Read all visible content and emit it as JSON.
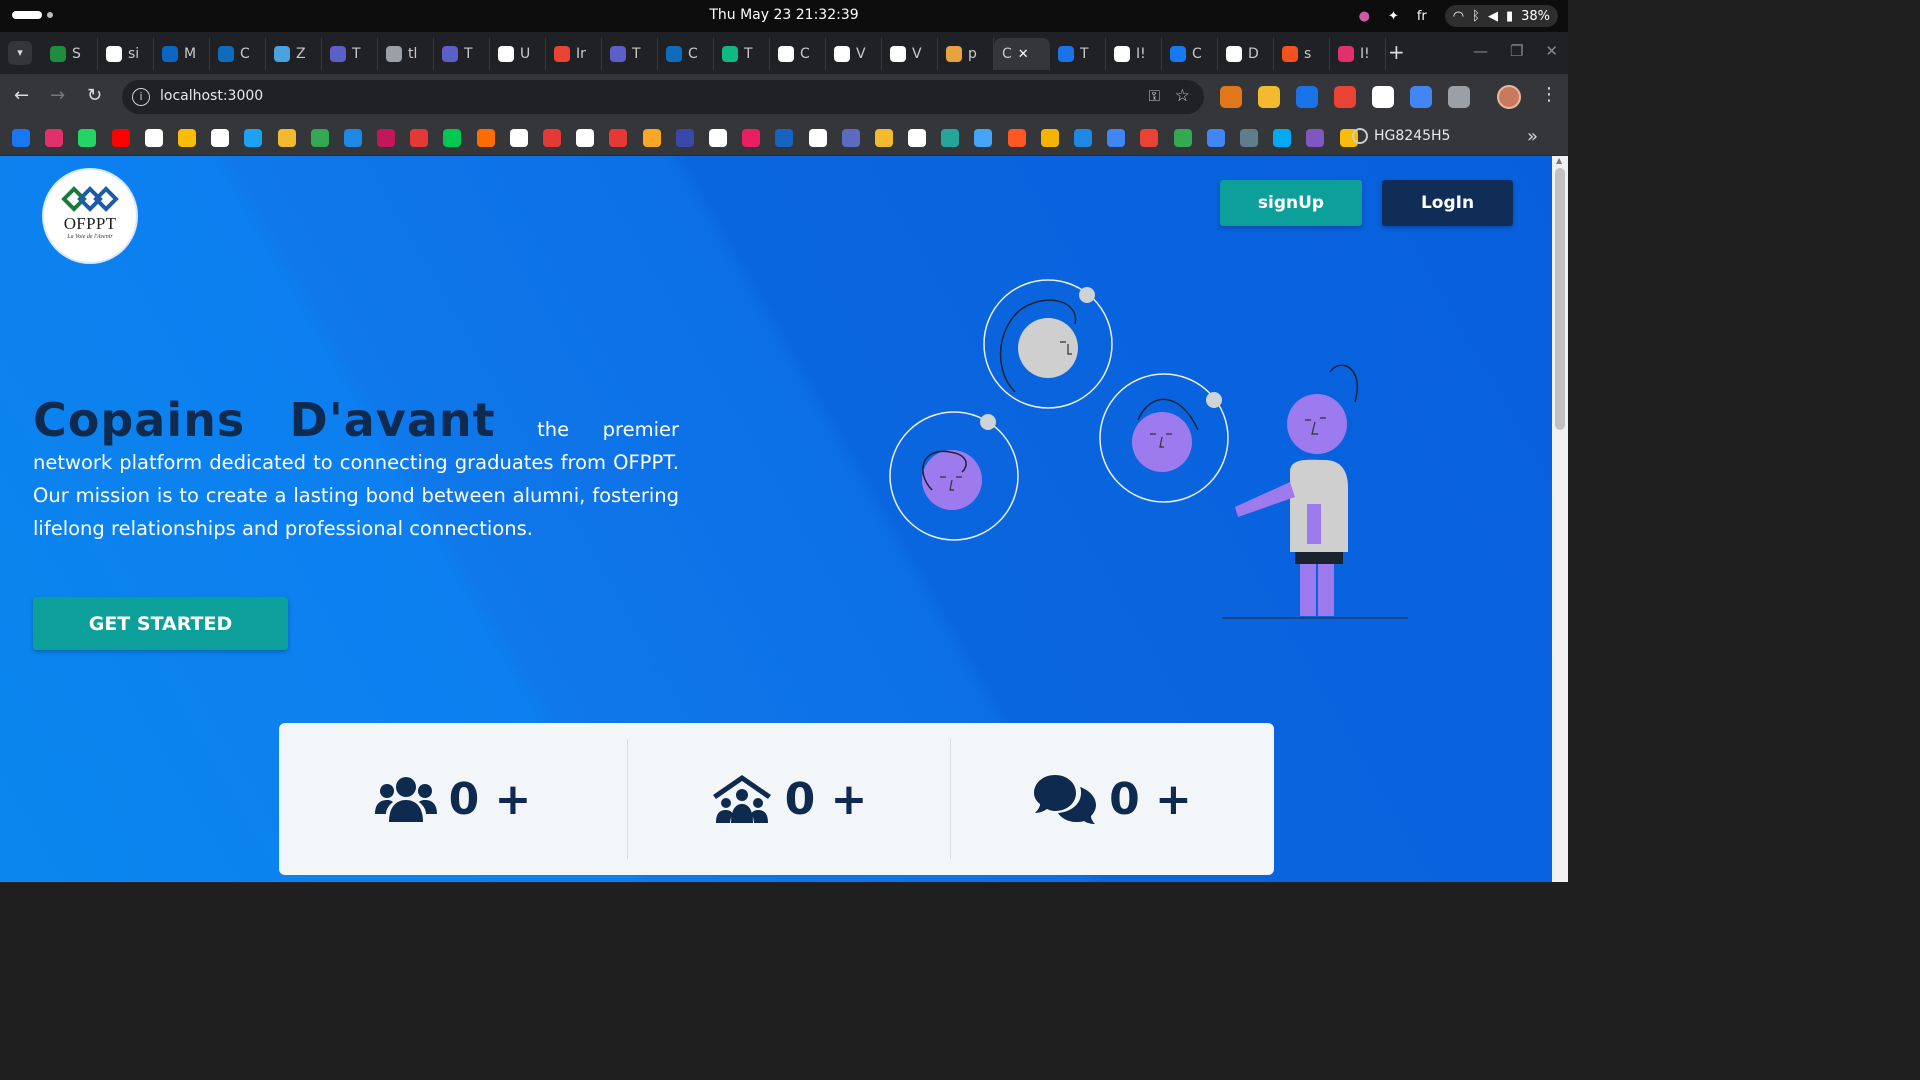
{
  "system_bar": {
    "clock": "Thu May 23  21:32:39",
    "language": "fr",
    "battery": "38%"
  },
  "browser": {
    "tabs": [
      {
        "label": "S",
        "favicon_color": "#1e8e3e"
      },
      {
        "label": "si",
        "favicon_color": "#ffffff"
      },
      {
        "label": "M",
        "favicon_color": "#0a66c2"
      },
      {
        "label": "C",
        "favicon_color": "#0f6cbd"
      },
      {
        "label": "Z",
        "favicon_color": "#4aa3df"
      },
      {
        "label": "T",
        "favicon_color": "#5b5fc7"
      },
      {
        "label": "tl",
        "favicon_color": "#9aa0a6"
      },
      {
        "label": "T",
        "favicon_color": "#5b5fc7"
      },
      {
        "label": "U",
        "favicon_color": "#ffffff"
      },
      {
        "label": "Ir",
        "favicon_color": "#ea4335"
      },
      {
        "label": "T",
        "favicon_color": "#5b5fc7"
      },
      {
        "label": "C",
        "favicon_color": "#0f6cbd"
      },
      {
        "label": "T",
        "favicon_color": "#10b981"
      },
      {
        "label": "C",
        "favicon_color": "#ffffff"
      },
      {
        "label": "V",
        "favicon_color": "#ffffff"
      },
      {
        "label": "V",
        "favicon_color": "#ffffff"
      },
      {
        "label": "p",
        "favicon_color": "#e8a33d"
      },
      {
        "label": "C",
        "favicon_color": "",
        "active": true
      },
      {
        "label": "T",
        "favicon_color": "#1a73e8"
      },
      {
        "label": "I!",
        "favicon_color": "#ffffff"
      },
      {
        "label": "C",
        "favicon_color": "#1877f2"
      },
      {
        "label": "D",
        "favicon_color": "#ffffff"
      },
      {
        "label": "s",
        "favicon_color": "#f4511e"
      },
      {
        "label": "I!",
        "favicon_color": "#e1306c"
      }
    ],
    "new_tab": "+",
    "url": "localhost:3000",
    "extension_colors": [
      "#e2761b",
      "#f3ba2f",
      "#1a73e8",
      "#ea4335",
      "#ffffff",
      "#4285f4",
      "#9aa0a6"
    ],
    "bookmark_colors": [
      "#1877f2",
      "#e1306c",
      "#25d366",
      "#ff0000",
      "#ffffff",
      "#fbbc05",
      "#ffffff",
      "#1da1f2",
      "#f3ba2f",
      "#34a853",
      "#1e88e5",
      "#c2185b",
      "#e53935",
      "#00c853",
      "#ff6d00",
      "#ffffff",
      "#e53935",
      "#ffffff",
      "#e53935",
      "#f9a825",
      "#3949ab",
      "#ffffff",
      "#e91e63",
      "#1565c0",
      "#ffffff",
      "#5c6bc0",
      "#f3ba2f",
      "#ffffff",
      "#26a69a",
      "#42a5f5",
      "#ff5722",
      "#f4b400",
      "#1e88e5",
      "#4285f4",
      "#ea4335",
      "#34a853",
      "#4285f4",
      "#607d8b",
      "#03a9f4",
      "#7e57c2",
      "#fbbc05"
    ],
    "bookmark_label": "HG8245H5"
  },
  "page": {
    "logo": {
      "name": "OFPPT",
      "tagline": "La Voie de l'Avenir"
    },
    "signup_label": "signUp",
    "login_label": "LogIn",
    "hero": {
      "title": "Copains  D'avant",
      "text": "the premier network platform dedicated to connecting graduates from OFPPT. Our mission is to create a lasting bond between alumni, fostering lifelong relationships and professional connections."
    },
    "cta_label": "GET STARTED",
    "stats": [
      {
        "icon": "users-icon",
        "value": "0 +"
      },
      {
        "icon": "community-icon",
        "value": "0 +"
      },
      {
        "icon": "comments-icon",
        "value": "0 +"
      }
    ],
    "colors": {
      "primary_dark": "#0e2a4f",
      "teal": "#0d9f9a",
      "background": "#0a78ea",
      "illustration_purple": "#9d7bef"
    }
  }
}
